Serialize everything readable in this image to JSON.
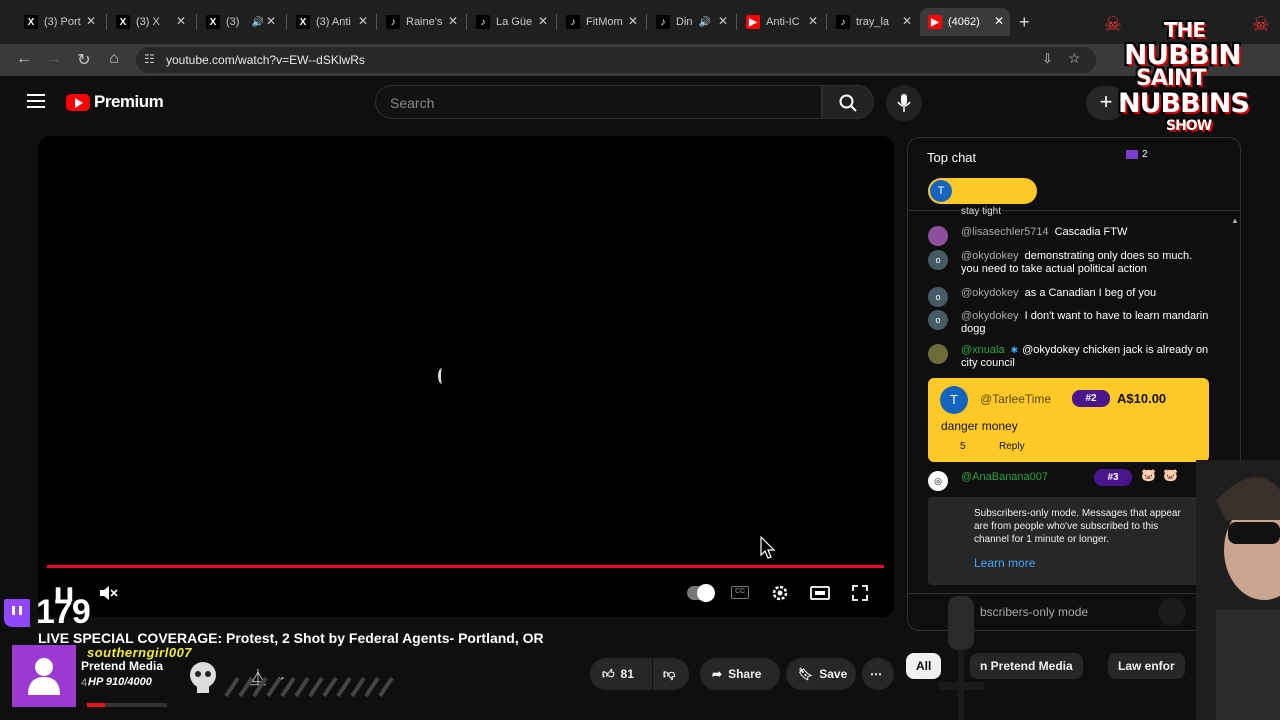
{
  "browser": {
    "tabs": [
      {
        "label": "(3) Port",
        "favicon": "x-icon"
      },
      {
        "label": "(3) X",
        "favicon": "x-icon"
      },
      {
        "label": "(3)",
        "favicon": "x-icon"
      },
      {
        "label": "(3) Anti",
        "favicon": "x-icon"
      },
      {
        "label": "Raine's",
        "favicon": "tiktok-icon"
      },
      {
        "label": "La Güe",
        "favicon": "tiktok-icon"
      },
      {
        "label": "FitMom",
        "favicon": "tiktok-icon"
      },
      {
        "label": "Din",
        "favicon": "tiktok-icon"
      },
      {
        "label": "Anti-IC",
        "favicon": "youtube-icon"
      },
      {
        "label": "tray_la",
        "favicon": "tiktok-icon"
      },
      {
        "label": "(4062)",
        "favicon": "youtube-icon"
      }
    ],
    "new_tab": "+",
    "url": "youtube.com/watch?v=EW--dSKlwRs"
  },
  "masthead": {
    "logo_text": "Premium",
    "search_placeholder": "Search",
    "create_label": "+"
  },
  "player": {
    "progress_percent": 100,
    "progress_color": "#ff0033"
  },
  "video": {
    "title": "LIVE SPECIAL COVERAGE: Protest, 2 Shot by Federal Agents- Portland, OR",
    "channel_name": "Pretend Media",
    "channel_subs": "4.",
    "like_count": "81",
    "share_label": "Share",
    "save_label": "Save"
  },
  "stream_overlay": {
    "viewer_count": "179",
    "username": "southerngirl007",
    "hp_text": "HP 910/4000",
    "hp_fraction": 0.2275,
    "show_logo": [
      "THE",
      "NUBBIN",
      "SAINT",
      "NUBBINS",
      "SHOW"
    ]
  },
  "chat": {
    "title": "Top chat",
    "viewer_badge": "2",
    "pinned_initial": "T",
    "partial_top": "stay tight",
    "messages": [
      {
        "author": "@lisasechler5714",
        "text": "Cascadia FTW",
        "initial": "",
        "member": false
      },
      {
        "author": "@okydokey",
        "text": "demonstrating only does so much. you need to take actual political action",
        "initial": "o",
        "member": false
      },
      {
        "author": "@okydokey",
        "text": "as a Canadian I beg of you",
        "initial": "o",
        "member": false
      },
      {
        "author": "@okydokey",
        "text": "I don't want to have to learn mandarin dogg",
        "initial": "o",
        "member": false
      },
      {
        "author": "@xnuala",
        "text": "@okydokey chicken jack is already on city council",
        "initial": "",
        "member": true
      }
    ],
    "superchat": {
      "initial": "T",
      "author": "@TarleeTime",
      "rank": "#2",
      "amount": "A$10.00",
      "text": "danger money",
      "likes": "5",
      "reply": "Reply"
    },
    "member_msg": {
      "author": "@AnaBanana007",
      "rank": "#3"
    },
    "notice": {
      "text": "Subscribers-only mode. Messages that appear are from people who've subscribed to this channel for 1 minute or longer.",
      "link": "Learn more"
    },
    "mode_label": "bscribers-only mode"
  },
  "chips": [
    {
      "label": "All",
      "active": true
    },
    {
      "label": "n Pretend Media",
      "active": false
    },
    {
      "label": "Law enfor",
      "active": false
    }
  ]
}
